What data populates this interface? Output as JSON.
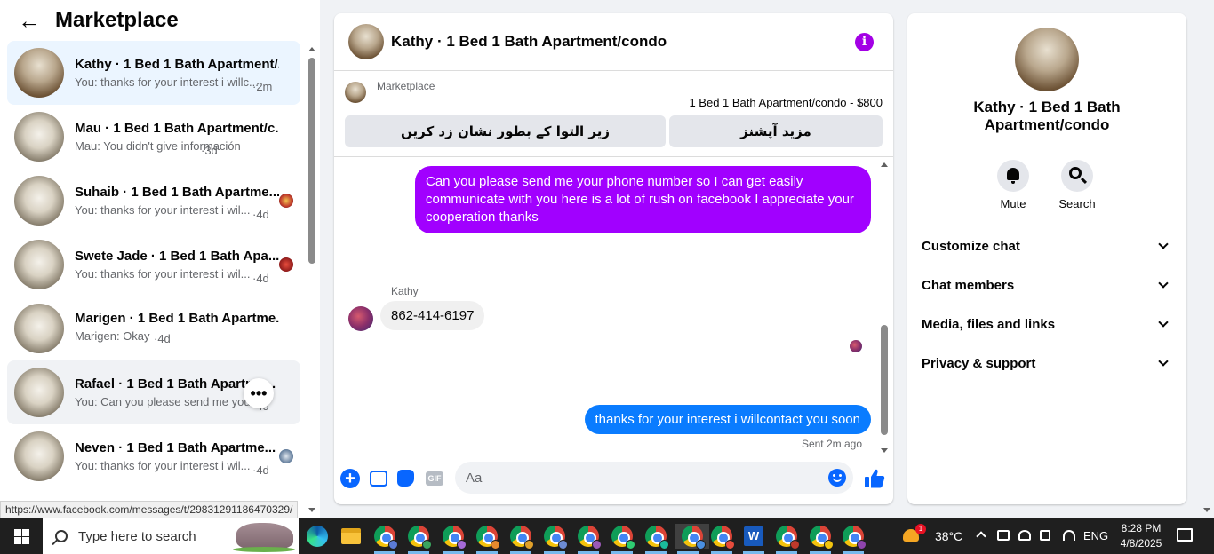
{
  "left": {
    "title": "Marketplace",
    "conversations": [
      {
        "name": "Kathy · 1 Bed 1 Bath Apartment/...",
        "preview": "You: thanks for your interest i willc...",
        "time": "·2m"
      },
      {
        "name": "Mau · 1 Bed 1 Bath Apartment/c...",
        "preview": "Mau: You didn't give información",
        "time": "·3d"
      },
      {
        "name": "Suhaib · 1 Bed 1 Bath Apartme...",
        "preview": "You: thanks for your interest i wil...",
        "time": "·4d"
      },
      {
        "name": "Swete Jade · 1 Bed 1 Bath Apa...",
        "preview": "You: thanks for your interest i wil...",
        "time": "·4d"
      },
      {
        "name": "Marigen · 1 Bed 1 Bath Apartme...",
        "preview": "Marigen: Okay",
        "time": "·4d"
      },
      {
        "name": "Rafael · 1 Bed 1 Bath Apartme...",
        "preview": "You: Can you please send me your ...",
        "time": "·4d"
      },
      {
        "name": "Neven · 1 Bed 1 Bath Apartme...",
        "preview": "You: thanks for your interest i wil...",
        "time": "·4d"
      }
    ],
    "more_label": "•••",
    "status_url": "https://www.facebook.com/messages/t/29831291186470329/"
  },
  "chat": {
    "title": "Kathy · 1 Bed 1 Bath Apartment/condo",
    "info_label": "i",
    "marketplace_label": "Marketplace",
    "listing_price": "1 Bed 1 Bath Apartment/condo - $800",
    "button_mark": "زیر التوا کے بطور نشان زد کریں",
    "button_more": "مزید آپشنز",
    "messages": {
      "out1": "Can you please send me your phone number so I can get easily communicate with you here is a lot of rush on facebook I appreciate your cooperation thanks",
      "sender": "Kathy",
      "in1": "862-414-6197",
      "out2": "thanks for your interest i willcontact you soon",
      "status": "Sent 2m ago"
    },
    "composer": {
      "placeholder": "Aa",
      "gif_label": "GIF",
      "plus_label": "+"
    }
  },
  "right": {
    "name": "Kathy · 1 Bed 1 Bath Apartment/condo",
    "actions": [
      {
        "label": "Mute"
      },
      {
        "label": "Search"
      }
    ],
    "sections": [
      {
        "label": "Customize chat"
      },
      {
        "label": "Chat members"
      },
      {
        "label": "Media, files and links"
      },
      {
        "label": "Privacy & support"
      }
    ]
  },
  "taskbar": {
    "search_placeholder": "Type here to search",
    "weather_badge": "1",
    "temperature": "38°C",
    "language": "ENG",
    "time": "8:28 PM",
    "date": "4/8/2025",
    "word_label": "W"
  },
  "colors": {
    "accent": "#0866ff",
    "theme_purple": "#a100ff",
    "outgoing_blue": "#0a7cff",
    "taskbar": "#1f1f1f"
  }
}
